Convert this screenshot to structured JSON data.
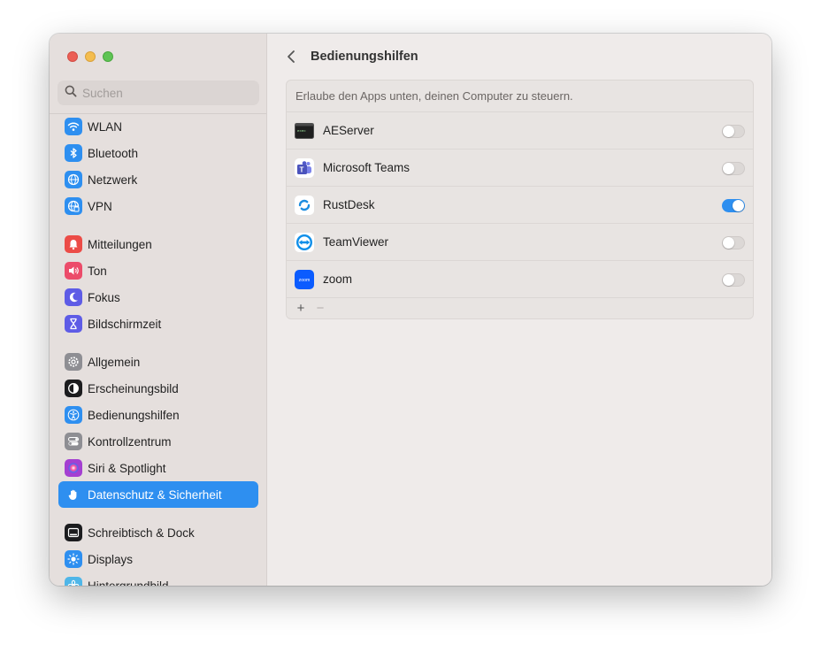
{
  "window": {
    "traffic_lights": [
      "close",
      "minimize",
      "zoom"
    ]
  },
  "sidebar": {
    "search": {
      "placeholder": "Suchen",
      "value": ""
    },
    "groups": [
      [
        {
          "label": "WLAN",
          "icon": "wifi-icon",
          "color": "#2e8ff0"
        },
        {
          "label": "Bluetooth",
          "icon": "bluetooth-icon",
          "color": "#2e8ff0"
        },
        {
          "label": "Netzwerk",
          "icon": "globe-icon",
          "color": "#2e8ff0"
        },
        {
          "label": "VPN",
          "icon": "vpn-globe-icon",
          "color": "#2e8ff0"
        }
      ],
      [
        {
          "label": "Mitteilungen",
          "icon": "bell-icon",
          "color": "#ec4c47"
        },
        {
          "label": "Ton",
          "icon": "speaker-icon",
          "color": "#ec4c6a"
        },
        {
          "label": "Fokus",
          "icon": "moon-icon",
          "color": "#5e5ce6"
        },
        {
          "label": "Bildschirmzeit",
          "icon": "hourglass-icon",
          "color": "#5e5ce6"
        }
      ],
      [
        {
          "label": "Allgemein",
          "icon": "gear-icon",
          "color": "#8e8e93"
        },
        {
          "label": "Erscheinungsbild",
          "icon": "appearance-icon",
          "color": "#1c1c1e"
        },
        {
          "label": "Bedienungshilfen",
          "icon": "accessibility-icon",
          "color": "#2e8ff0"
        },
        {
          "label": "Kontrollzentrum",
          "icon": "toggles-icon",
          "color": "#8e8e93"
        },
        {
          "label": "Siri & Spotlight",
          "icon": "siri-icon",
          "color": "#a43fd1"
        },
        {
          "label": "Datenschutz & Sicherheit",
          "icon": "hand-icon",
          "color": "#2e8ff0",
          "selected": true
        }
      ],
      [
        {
          "label": "Schreibtisch & Dock",
          "icon": "dock-icon",
          "color": "#1c1c1e"
        },
        {
          "label": "Displays",
          "icon": "sun-icon",
          "color": "#2e8ff0"
        },
        {
          "label": "Hintergrundbild",
          "icon": "wallpaper-icon",
          "color": "#4fb6e8"
        }
      ]
    ]
  },
  "main": {
    "title": "Bedienungshilfen",
    "description": "Erlaube den Apps unten, deinen Computer zu steuern.",
    "apps": [
      {
        "name": "AEServer",
        "icon": "terminal-icon",
        "enabled": false
      },
      {
        "name": "Microsoft Teams",
        "icon": "teams-icon",
        "enabled": false
      },
      {
        "name": "RustDesk",
        "icon": "rustdesk-icon",
        "enabled": true
      },
      {
        "name": "TeamViewer",
        "icon": "teamviewer-icon",
        "enabled": false
      },
      {
        "name": "zoom",
        "icon": "zoom-icon",
        "enabled": false
      }
    ],
    "footer": {
      "add": "+",
      "remove": "−"
    }
  }
}
